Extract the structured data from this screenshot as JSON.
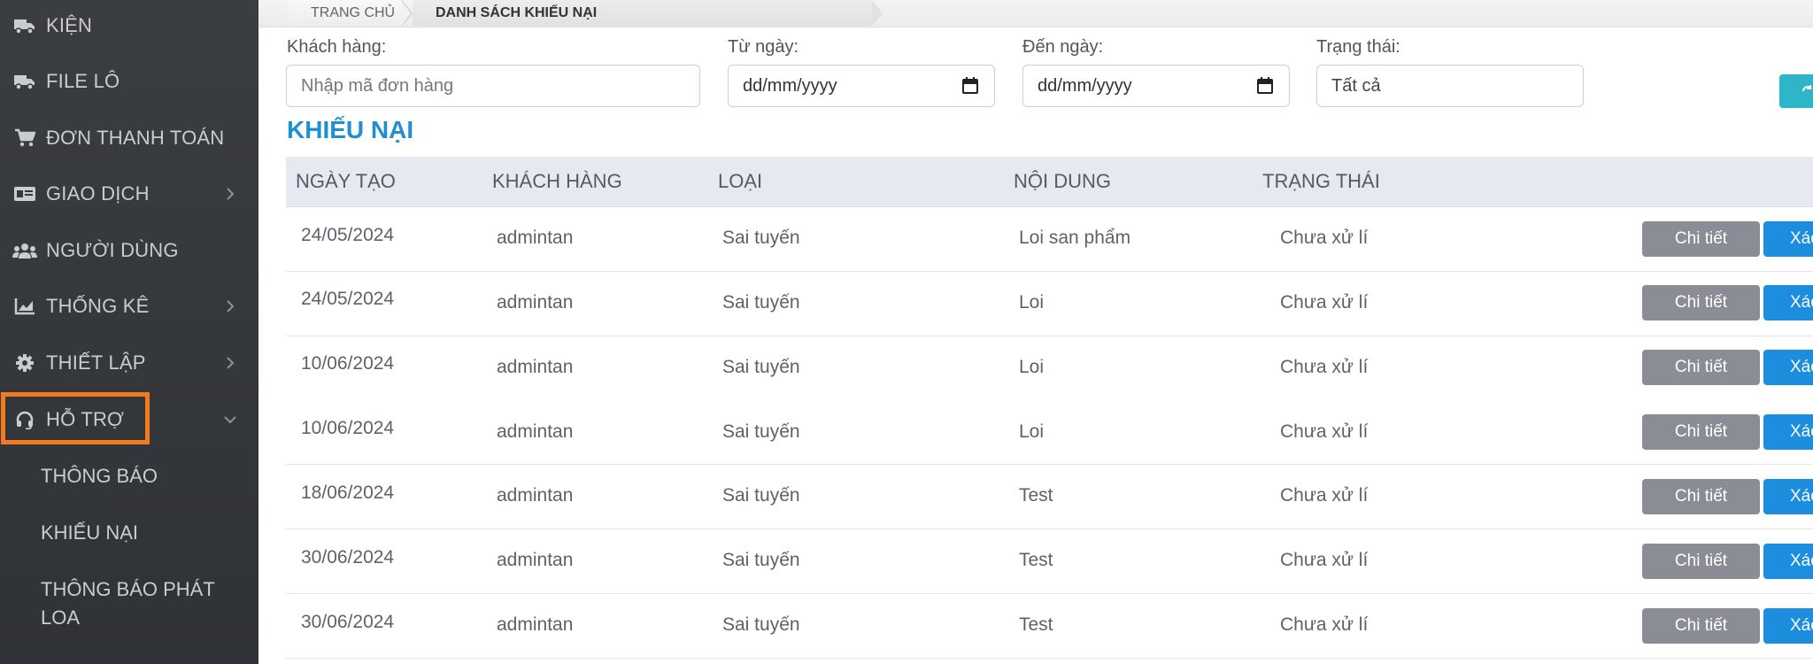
{
  "sidebar": {
    "items": [
      {
        "label": "KIỆN",
        "icon": "truck-icon"
      },
      {
        "label": "FILE LÔ",
        "icon": "truck-icon"
      },
      {
        "label": "ĐƠN THANH TOÁN",
        "icon": "cart-icon"
      },
      {
        "label": "GIAO DỊCH",
        "icon": "id-card-icon",
        "chevron": "chevron-right-icon"
      },
      {
        "label": "NGƯỜI DÙNG",
        "icon": "users-icon"
      },
      {
        "label": "THỐNG KÊ",
        "icon": "chart-icon",
        "chevron": "chevron-right-icon"
      },
      {
        "label": "THIẾT LẬP",
        "icon": "gear-icon",
        "chevron": "chevron-right-icon"
      },
      {
        "label": "HỖ TRỢ",
        "icon": "headset-icon",
        "chevron": "chevron-down-icon"
      }
    ],
    "subitems": [
      {
        "label": "THÔNG BÁO"
      },
      {
        "label": "KHIẾU NẠI"
      },
      {
        "label": "THÔNG BÁO PHÁT",
        "label2": "LOA"
      }
    ],
    "highlight_color": "#f47a20"
  },
  "breadcrumb": {
    "home": "TRANG CHỦ",
    "current": "DANH SÁCH KHIẾU NẠI"
  },
  "filters": {
    "customer_label": "Khách hàng:",
    "customer_placeholder": "Nhập mã đơn hàng",
    "from_label": "Từ ngày:",
    "from_value": "dd/mm/yyyy",
    "to_label": "Đến ngày:",
    "to_value": "dd/mm/yyyy",
    "status_label": "Trạng thái:",
    "status_value": "Tất cả"
  },
  "section_title": "KHIẾU NẠI",
  "table": {
    "headers": [
      "NGÀY TẠO",
      "KHÁCH HÀNG",
      "LOẠI",
      "NỘI DUNG",
      "TRẠNG THÁI"
    ],
    "rows": [
      {
        "date": "24/05/2024",
        "customer": "admintan",
        "type": "Sai tuyến",
        "content": "Loi san phẩm",
        "status": "Chưa xử lí"
      },
      {
        "date": "24/05/2024",
        "customer": "admintan",
        "type": "Sai tuyến",
        "content": "Loi",
        "status": "Chưa xử lí"
      },
      {
        "date": "10/06/2024",
        "customer": "admintan",
        "type": "Sai tuyến",
        "content": "Loi",
        "status": "Chưa xử lí"
      },
      {
        "date": "10/06/2024",
        "customer": "admintan",
        "type": "Sai tuyến",
        "content": "Loi",
        "status": "Chưa xử lí"
      },
      {
        "date": "18/06/2024",
        "customer": "admintan",
        "type": "Sai tuyến",
        "content": "Test",
        "status": "Chưa xử lí"
      },
      {
        "date": "30/06/2024",
        "customer": "admintan",
        "type": "Sai tuyến",
        "content": "Test",
        "status": "Chưa xử lí"
      },
      {
        "date": "30/06/2024",
        "customer": "admintan",
        "type": "Sai tuyến",
        "content": "Test",
        "status": "Chưa xử lí"
      }
    ],
    "detail_label": "Chi tiết",
    "delete_label": "Xác"
  },
  "colors": {
    "accent": "#1f8fd1",
    "detail_btn": "#8a8d96",
    "delete_btn": "#1d8ddd",
    "refresh_btn": "#2fb5c8"
  }
}
